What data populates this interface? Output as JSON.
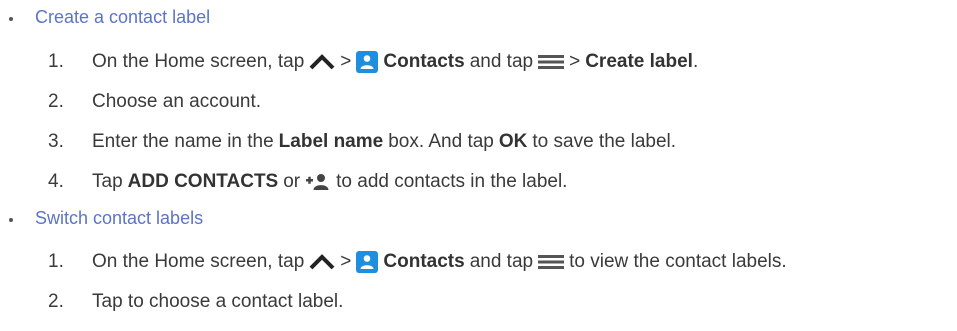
{
  "sections": [
    {
      "heading": "Create a contact label",
      "steps": [
        {
          "num": "1.",
          "parts": {
            "a": "On the Home screen, tap",
            "gt1": ">",
            "contacts": "Contacts",
            "b": "and tap",
            "gt2": ">",
            "create_label": "Create label",
            "end": "."
          }
        },
        {
          "num": "2.",
          "parts": {
            "a": "Choose an account."
          }
        },
        {
          "num": "3.",
          "parts": {
            "a": "Enter the name in the",
            "label_name": "Label name",
            "b": "box. And tap",
            "ok": "OK",
            "c": "to save the label."
          }
        },
        {
          "num": "4.",
          "parts": {
            "a": "Tap",
            "add_contacts": "ADD CONTACTS",
            "b": "or",
            "c": "to add contacts in the label."
          }
        }
      ]
    },
    {
      "heading": "Switch contact labels",
      "steps": [
        {
          "num": "1.",
          "parts": {
            "a": "On the Home screen, tap",
            "gt1": ">",
            "contacts": "Contacts",
            "b": "and tap",
            "c": "to view the contact labels."
          }
        },
        {
          "num": "2.",
          "parts": {
            "a": "Tap to choose a contact label."
          }
        }
      ]
    }
  ],
  "icons": {
    "apps": "chevron-up-icon",
    "contacts": "contacts-app-icon",
    "menu": "menu-icon",
    "add_contact": "add-contact-icon"
  },
  "colors": {
    "heading": "#5b74c6",
    "contacts_icon": "#1d8fe1",
    "text": "#3a3a3a"
  }
}
